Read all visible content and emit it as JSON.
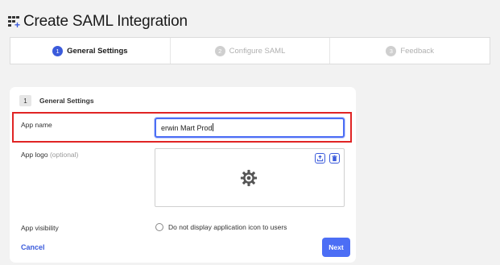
{
  "page": {
    "title": "Create SAML Integration"
  },
  "stepper": {
    "steps": [
      {
        "number": "1",
        "label": "General Settings",
        "state": "active"
      },
      {
        "number": "2",
        "label": "Configure SAML",
        "state": "inactive"
      },
      {
        "number": "3",
        "label": "Feedback",
        "state": "inactive"
      }
    ]
  },
  "card": {
    "step_number": "1",
    "title": "General Settings",
    "app_name": {
      "label": "App name",
      "value": "erwin Mart Prod"
    },
    "app_logo": {
      "label": "App logo",
      "optional": "(optional)"
    },
    "app_visibility": {
      "label": "App visibility",
      "option": "Do not display application icon to users",
      "checked": false
    },
    "cancel_label": "Cancel",
    "next_label": "Next"
  },
  "colors": {
    "accent": "#4c6ef5",
    "highlight": "#e02424"
  }
}
